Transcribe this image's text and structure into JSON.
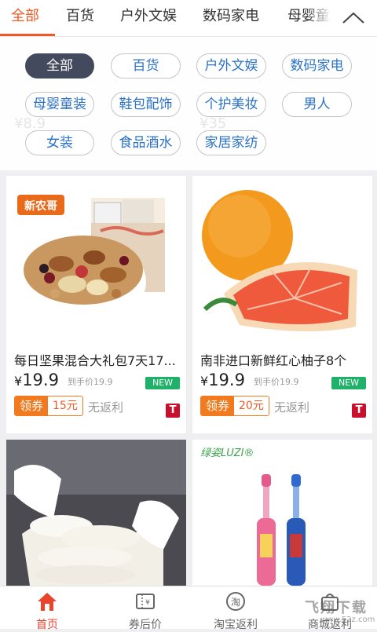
{
  "tabs": [
    "全部",
    "百货",
    "户外文娱",
    "数码家电",
    "母婴童"
  ],
  "categories": [
    "全部",
    "百货",
    "户外文娱",
    "数码家电",
    "母婴童装",
    "鞋包配饰",
    "个护美妆",
    "男人",
    "女装",
    "食品酒水",
    "家居家纺"
  ],
  "products": [
    {
      "title": "每日坚果混合大礼包7天17...",
      "currency": "¥",
      "price": "19.9",
      "orig_price": "到手价19.9",
      "badge": "NEW",
      "coupon_label": "领券",
      "coupon_value": "15元",
      "rebate": "无返利",
      "store_icon": "T",
      "brand_label": "新农哥"
    },
    {
      "title": "南非进口新鲜红心柚子8个",
      "currency": "¥",
      "price": "19.9",
      "orig_price": "到手价19.9",
      "badge": "NEW",
      "coupon_label": "领券",
      "coupon_value": "20元",
      "rebate": "无返利",
      "store_icon": "T"
    },
    {
      "image_desc": "white rice noodles held by gloved hands"
    },
    {
      "brand_label": "绿姿LUZI®"
    }
  ],
  "bottom_nav": [
    {
      "label": "首页",
      "icon": "home-icon",
      "active": true
    },
    {
      "label": "券后价",
      "icon": "ticket-icon",
      "active": false
    },
    {
      "label": "淘宝返利",
      "icon": "taobao-icon",
      "active": false
    },
    {
      "label": "商城返利",
      "icon": "mall-icon",
      "active": false
    }
  ],
  "watermark": {
    "text": "飞翔下载",
    "url": "www.52z.com"
  },
  "colors": {
    "accent": "#f05a24",
    "chip_selected": "#444a5e",
    "chip_text": "#2a72c9",
    "badge_new": "#1fb06a",
    "coupon": "#f07a1d",
    "tmall": "#c8102e"
  }
}
